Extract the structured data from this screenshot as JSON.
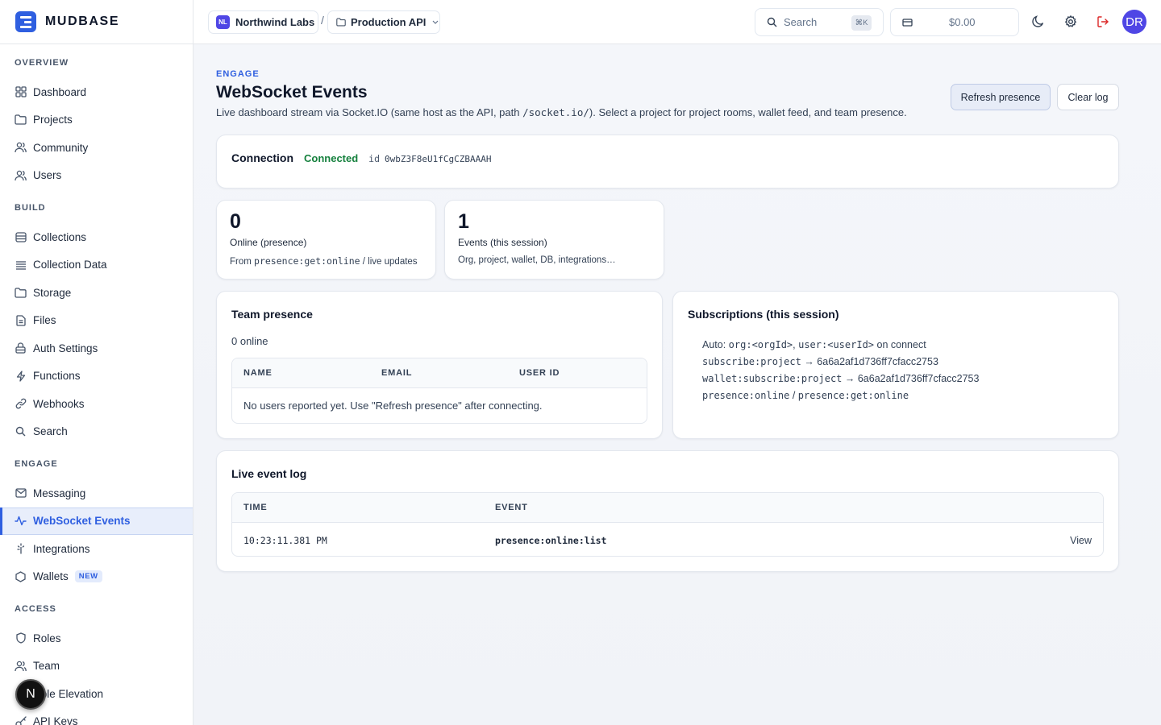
{
  "brand": {
    "name": "MUDBASE"
  },
  "sidebar": {
    "sections": [
      {
        "title": "OVERVIEW",
        "items": [
          {
            "label": "Dashboard",
            "icon": "grid-icon"
          },
          {
            "label": "Projects",
            "icon": "folder-icon"
          },
          {
            "label": "Community",
            "icon": "users-icon"
          },
          {
            "label": "Users",
            "icon": "users-icon"
          }
        ]
      },
      {
        "title": "BUILD",
        "items": [
          {
            "label": "Collections",
            "icon": "database-icon"
          },
          {
            "label": "Collection Data",
            "icon": "list-icon"
          },
          {
            "label": "Storage",
            "icon": "folder-icon"
          },
          {
            "label": "Files",
            "icon": "file-icon"
          },
          {
            "label": "Auth Settings",
            "icon": "lock-icon"
          },
          {
            "label": "Functions",
            "icon": "bolt-icon"
          },
          {
            "label": "Webhooks",
            "icon": "link-icon"
          },
          {
            "label": "Search",
            "icon": "search-icon"
          }
        ]
      },
      {
        "title": "ENGAGE",
        "items": [
          {
            "label": "Messaging",
            "icon": "mail-icon"
          },
          {
            "label": "WebSocket Events",
            "icon": "activity-icon",
            "active": true
          },
          {
            "label": "Integrations",
            "icon": "plug-icon"
          },
          {
            "label": "Wallets",
            "icon": "hexagon-icon",
            "badge": "NEW"
          }
        ]
      },
      {
        "title": "ACCESS",
        "items": [
          {
            "label": "Roles",
            "icon": "shield-icon"
          },
          {
            "label": "Team",
            "icon": "users-icon"
          },
          {
            "label": "Role Elevation",
            "icon": "shield-icon"
          },
          {
            "label": "API Keys",
            "icon": "key-icon"
          }
        ]
      }
    ],
    "floating_badge": "N"
  },
  "topbar": {
    "org": {
      "initials": "NL",
      "name": "Northwind Labs"
    },
    "separator": "/",
    "project": {
      "name": "Production API"
    },
    "search": {
      "placeholder": "Search",
      "shortcut": "⌘K"
    },
    "balance": "$0.00",
    "user_initials": "DR"
  },
  "page": {
    "kicker": "ENGAGE",
    "title": "WebSocket Events",
    "desc_before": "Live dashboard stream via Socket.IO (same host as the API, path ",
    "desc_code": "/socket.io/",
    "desc_after": "). Select a project for project rooms, wallet feed, and team presence.",
    "refresh_label": "Refresh presence",
    "clear_label": "Clear log"
  },
  "connection": {
    "label": "Connection",
    "status": "Connected",
    "id_label": "id",
    "id": "0wbZ3F8eU1fCgCZBAAAH"
  },
  "stats": [
    {
      "value": "0",
      "label": "Online (presence)",
      "sub_before": "From ",
      "sub_code": "presence:get:online",
      "sub_after": " / live updates"
    },
    {
      "value": "1",
      "label": "Events (this session)",
      "sub_before": "Org, project, wallet, DB, integrations…",
      "sub_code": "",
      "sub_after": ""
    }
  ],
  "team_presence": {
    "title": "Team presence",
    "online_text": "0 online",
    "columns": [
      "NAME",
      "EMAIL",
      "USER ID"
    ],
    "empty_message": "No users reported yet. Use \"Refresh presence\" after connecting."
  },
  "subscriptions": {
    "title": "Subscriptions (this session)",
    "auto_label": "Auto: ",
    "auto_org": "org:<orgId>",
    "auto_sep": ", ",
    "auto_user": "user:<userId>",
    "auto_after": " on connect",
    "project_event": "subscribe:project",
    "project_id": "6a6a2af1d736ff7cfacc2753",
    "wallet_event": "wallet:subscribe:project",
    "wallet_id": "6a6a2af1d736ff7cfacc2753",
    "arrow": "→",
    "presence_a": "presence:online",
    "presence_sep": " / ",
    "presence_b": "presence:get:online"
  },
  "event_log": {
    "title": "Live event log",
    "columns": [
      "TIME",
      "EVENT"
    ],
    "rows": [
      {
        "time": "10:23:11.381 PM",
        "event": "presence:online:list",
        "action": "View"
      }
    ]
  },
  "colors": {
    "accent": "#2f5fe0",
    "connected": "#15803d",
    "logout": "#dc2626",
    "avatar": "#4f46e5"
  }
}
